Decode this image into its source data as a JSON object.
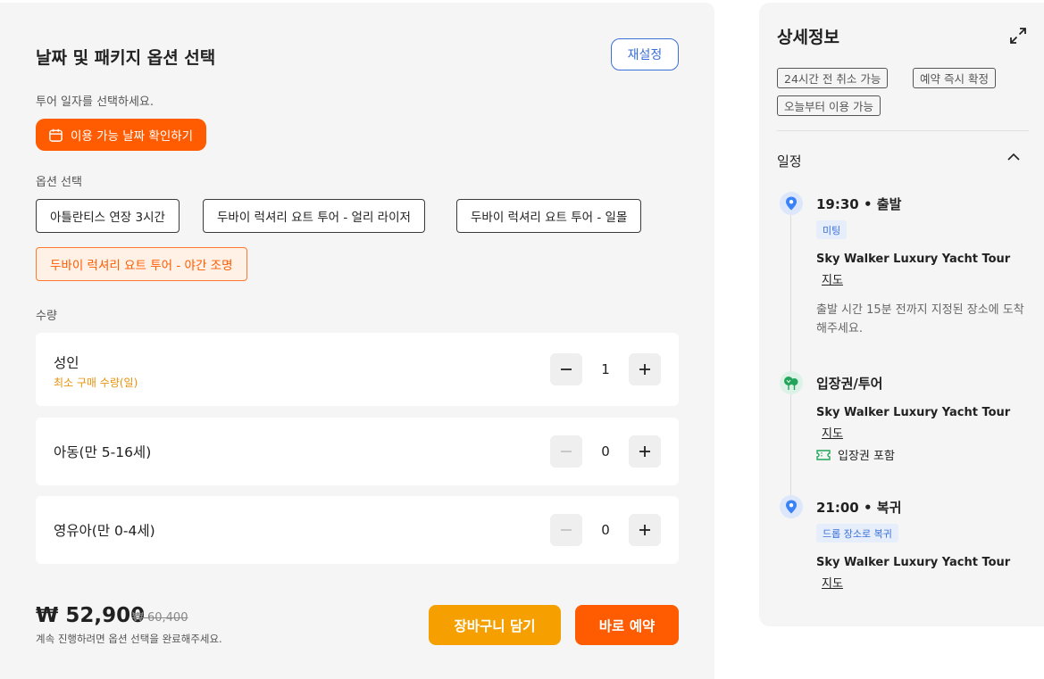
{
  "booking": {
    "title": "날짜 및 패키지 옵션 선택",
    "reset_label": "재설정",
    "date_prompt": "투어 일자를 선택하세요.",
    "date_button": "이용 가능 날짜 확인하기",
    "option_label": "옵션 선택",
    "options": [
      "아틀란티스 연장 3시간",
      "두바이 럭셔리 요트 투어 - 얼리 라이저",
      "두바이 럭셔리 요트 투어 - 일몰",
      "두바이 럭셔리 요트 투어 - 야간 조명"
    ],
    "selected_option": "두바이 럭셔리 요트 투어 - 야간 조명",
    "quantity_label": "수량",
    "quantities": [
      {
        "name": "성인",
        "sub": "최소 구매 수량(일)",
        "value": "1"
      },
      {
        "name": "아동(만 5-16세)",
        "sub": "",
        "value": "0"
      },
      {
        "name": "영유아(만 0-4세)",
        "sub": "",
        "value": "0"
      }
    ],
    "price": "₩ 52,900",
    "old_price": "₩ 60,400",
    "notice": "계속 진행하려면 옵션 선택을 완료해주세요.",
    "cart_label": "장바구니 담기",
    "book_label": "바로 예약"
  },
  "details": {
    "title": "상세정보",
    "tags": [
      "24시간 전 취소 가능",
      "예약 즉시 확정",
      "오늘부터 이용 가능"
    ],
    "schedule_label": "일정",
    "timeline": [
      {
        "head": "19:30  •  출발",
        "badge": "미팅",
        "place": "Sky Walker Luxury Yacht Tour",
        "map": "지도",
        "desc": "출발 시간 15분 전까지 지정된 장소에 도착해주세요."
      },
      {
        "head": "입장권/투어",
        "place": "Sky Walker Luxury Yacht Tour",
        "map": "지도",
        "included": "입장권 포함"
      },
      {
        "head": "21:00  •  복귀",
        "badge": "드롭 장소로 복귀",
        "place": "Sky Walker Luxury Yacht Tour",
        "map": "지도"
      }
    ]
  },
  "colors": {
    "accent_orange": "#ff5b00",
    "cart_yellow": "#f5a000",
    "link_blue": "#3b6fd8",
    "panel_bg": "#f5f5f5"
  },
  "icons": [
    "calendar-icon",
    "minus-icon",
    "plus-icon",
    "expand-icon",
    "chevron-up-icon",
    "location-pin-icon",
    "tree-icon",
    "ticket-icon"
  ]
}
